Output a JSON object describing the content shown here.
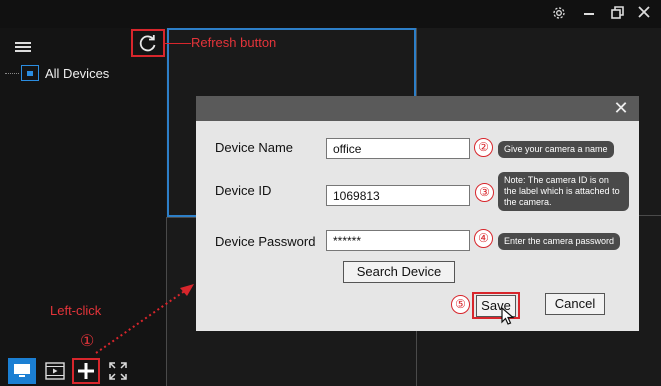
{
  "titlebar": {
    "buttons": [
      {
        "name": "settings-icon",
        "glyph": "gear"
      },
      {
        "name": "minimize-icon",
        "glyph": "minimize"
      },
      {
        "name": "restore-icon",
        "glyph": "restore"
      },
      {
        "name": "close-icon",
        "glyph": "close"
      }
    ]
  },
  "sidebar": {
    "menu_icon": "hamburger-icon",
    "tree": {
      "label": "All Devices",
      "icon": "camera-icon"
    }
  },
  "annotations": {
    "refresh_label": "Refresh button",
    "left_click": "Left-click",
    "step1": "①",
    "step2": "②",
    "step3": "③",
    "step4": "④",
    "step5": "⑤",
    "tip_name": "Give your camera a name",
    "tip_id": "Note: The camera ID is on the label which is attached to the camera.",
    "tip_password": "Enter the camera password"
  },
  "dialog": {
    "close_glyph": "✕",
    "device_name_label": "Device Name",
    "device_name_value": "office",
    "device_id_label": "Device ID",
    "device_id_value": "1069813",
    "device_password_label": "Device Password",
    "device_password_value": "******",
    "search_button": "Search Device",
    "save_button": "Save",
    "cancel_button": "Cancel"
  },
  "bottom_bar": {
    "buttons": [
      "monitor-icon",
      "playback-icon",
      "add-device-icon",
      "fullscreen-icon"
    ]
  },
  "colors": {
    "accent_blue": "#1b7fd3",
    "annotation_red": "#d8262c",
    "dialog_bg": "#e6e6e6",
    "app_bg": "#1a1a1a"
  }
}
